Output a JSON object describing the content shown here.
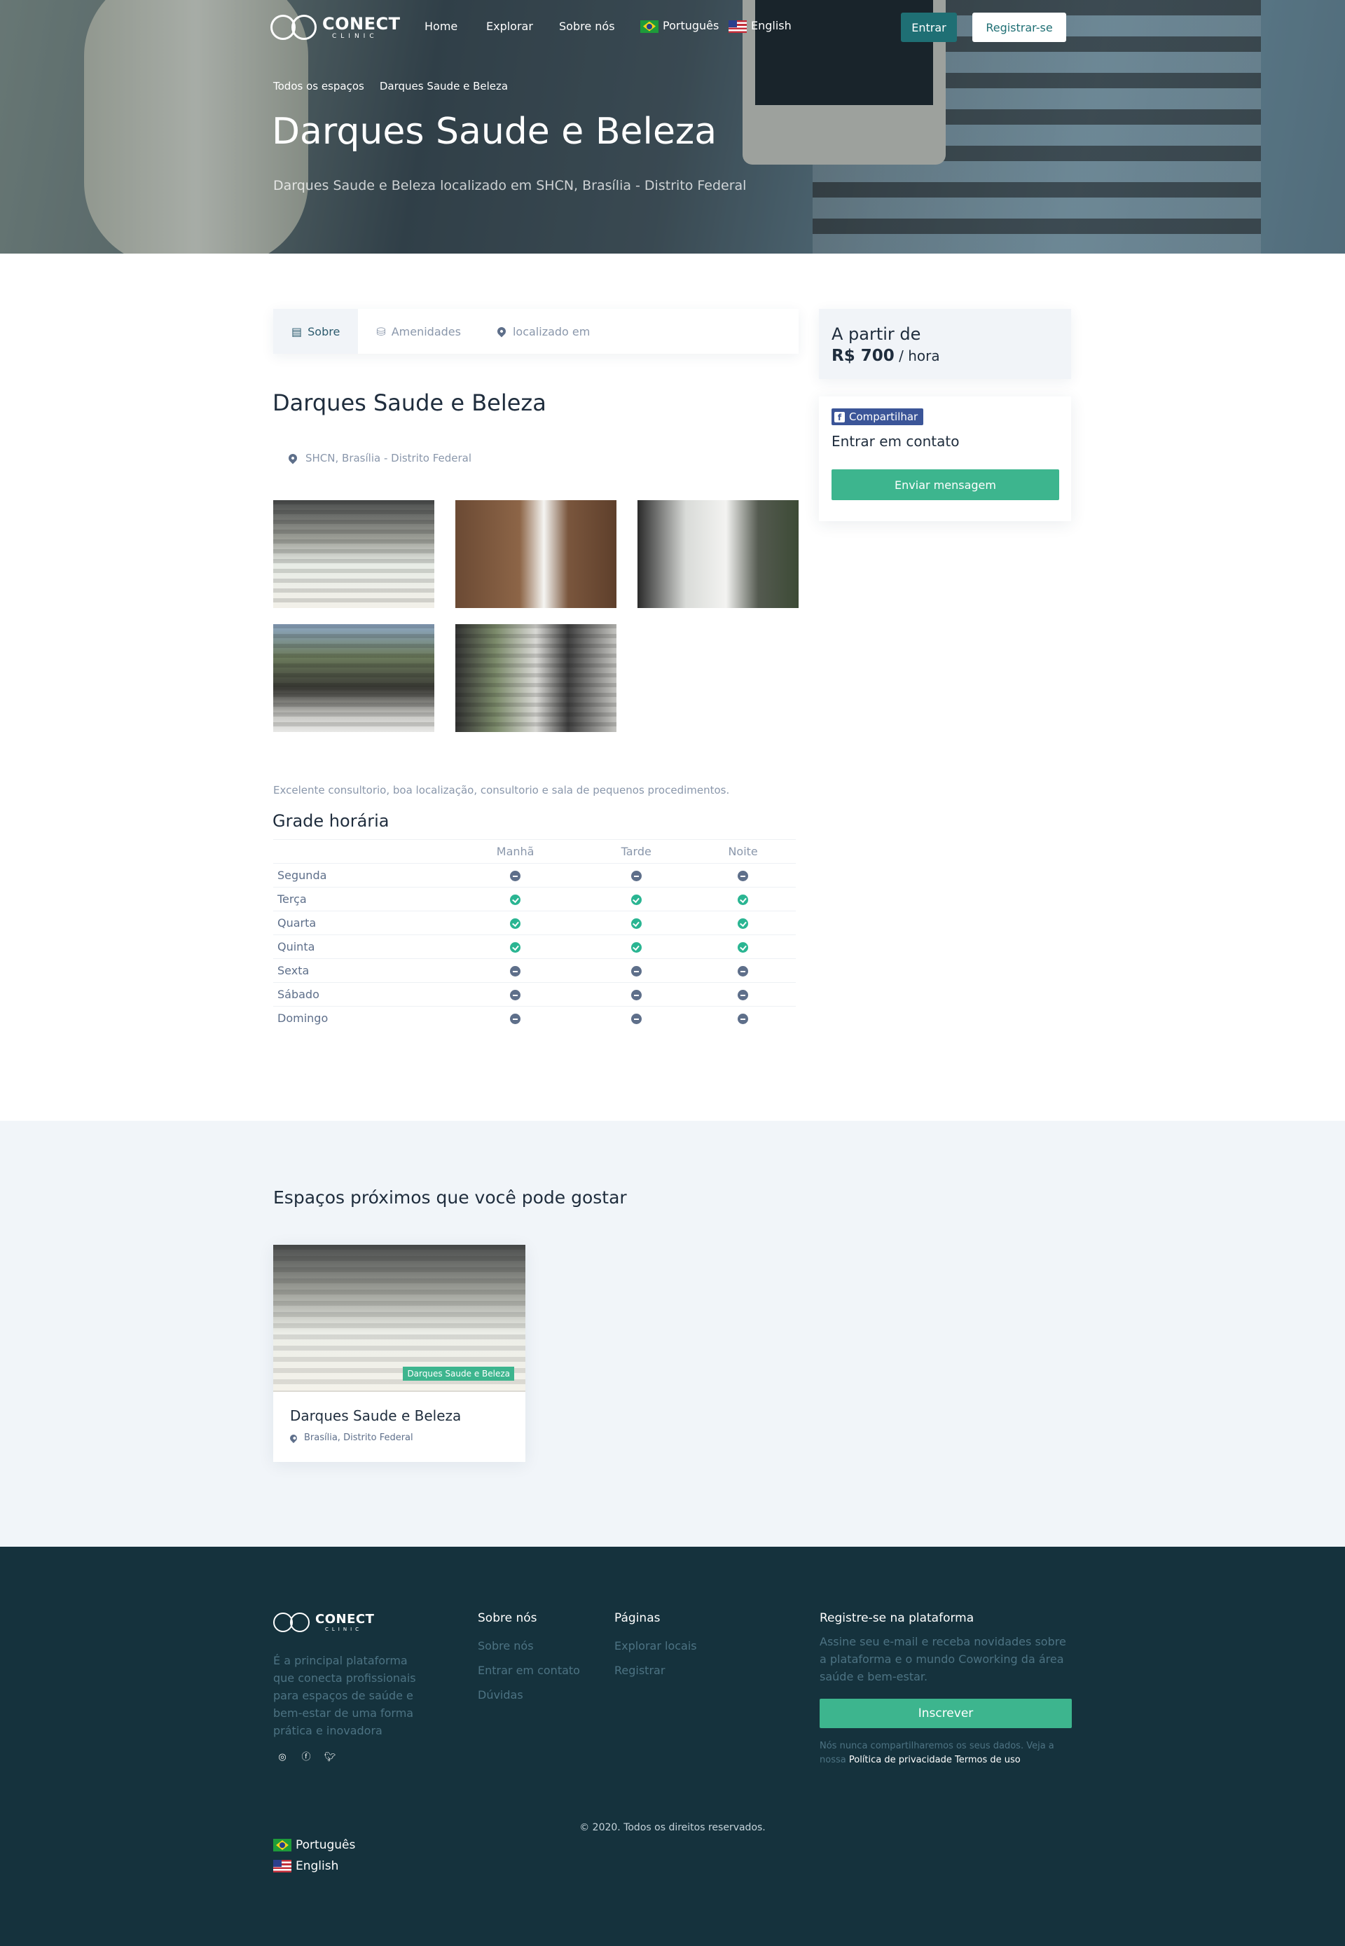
{
  "brand": {
    "name": "CONECT",
    "tagline": "CLINIC"
  },
  "nav": {
    "links": [
      "Home",
      "Explorar",
      "Sobre nós"
    ],
    "languages": [
      "Português",
      "English"
    ],
    "login_label": "Entrar",
    "register_label": "Registrar-se"
  },
  "breadcrumb": [
    "Todos os espaços",
    "Darques Saude e Beleza"
  ],
  "hero": {
    "title": "Darques Saude e Beleza",
    "subtitle": "Darques Saude e Beleza localizado em SHCN, Brasília - Distrito Federal"
  },
  "tabs": [
    "Sobre",
    "Amenidades",
    "localizado em"
  ],
  "listing": {
    "title": "Darques Saude e Beleza",
    "address": "SHCN, Brasília - Distrito Federal",
    "description": "Excelente consultorio, boa localização, consultorio e sala de pequenos procedimentos."
  },
  "schedule": {
    "title": "Grade horária",
    "columns": [
      "Manhã",
      "Tarde",
      "Noite"
    ],
    "rows": [
      {
        "day": "Segunda",
        "slots": [
          false,
          false,
          false
        ]
      },
      {
        "day": "Terça",
        "slots": [
          true,
          true,
          true
        ]
      },
      {
        "day": "Quarta",
        "slots": [
          true,
          true,
          true
        ]
      },
      {
        "day": "Quinta",
        "slots": [
          true,
          true,
          true
        ]
      },
      {
        "day": "Sexta",
        "slots": [
          false,
          false,
          false
        ]
      },
      {
        "day": "Sábado",
        "slots": [
          false,
          false,
          false
        ]
      },
      {
        "day": "Domingo",
        "slots": [
          false,
          false,
          false
        ]
      }
    ]
  },
  "pricing": {
    "prefix": "A partir de",
    "price": "R$ 700",
    "unit": "/ hora"
  },
  "contact": {
    "share_label": "Compartilhar",
    "title": "Entrar em contato",
    "send_label": "Enviar mensagem"
  },
  "nearby": {
    "title": "Espaços próximos que você pode gostar",
    "cards": [
      {
        "badge": "Darques Saude e Beleza",
        "name": "Darques Saude e Beleza",
        "location": "Brasília, Distrito Federal"
      }
    ]
  },
  "footer": {
    "about": "É a principal plataforma que conecta profissionais para espaços de saúde e bem-estar de uma forma prática e inovadora",
    "col1": {
      "title": "Sobre nós",
      "links": [
        "Sobre nós",
        "Entrar em contato",
        "Dúvidas"
      ]
    },
    "col2": {
      "title": "Páginas",
      "links": [
        "Explorar locais",
        "Registrar"
      ]
    },
    "register": {
      "title": "Registre-se na plataforma",
      "text": "Assine seu e-mail e receba novidades sobre a plataforma e o mundo Coworking da área saúde e bem-estar.",
      "button": "Inscrever",
      "privacy_text": "Nós nunca compartilharemos os seus dados. Veja a nossa",
      "privacy_link": "Política de privacidade",
      "terms_link": "Termos de uso"
    },
    "copyright": "© 2020. Todos os direitos reservados.",
    "languages": [
      "Português",
      "English"
    ]
  },
  "colors": {
    "primary": "#1f6f74",
    "accent": "#3db58e",
    "footer_bg": "#15323d",
    "facebook": "#3b5598"
  },
  "icons": {
    "social": [
      "instagram-icon",
      "facebook-icon",
      "twitter-icon"
    ]
  }
}
